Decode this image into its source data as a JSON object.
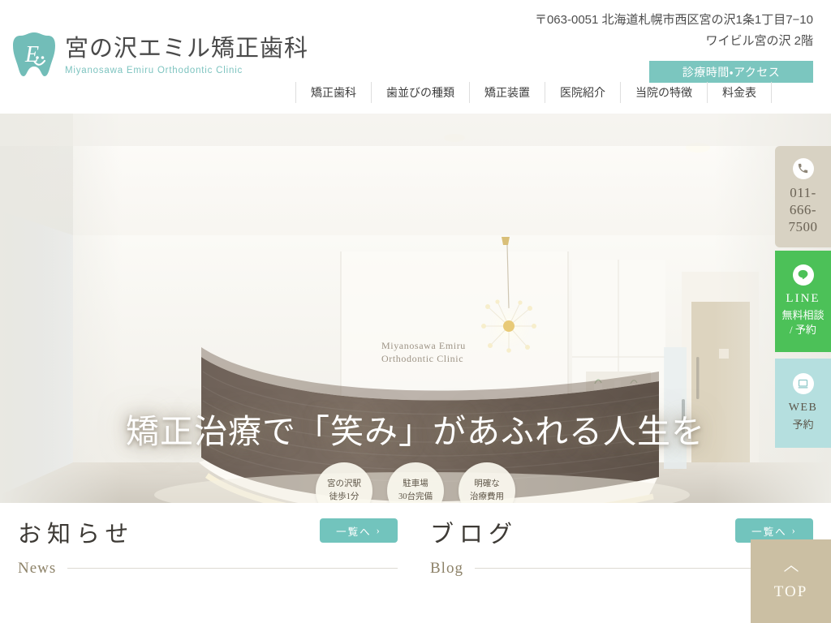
{
  "header": {
    "logo": {
      "icon": "tooth-logo-icon",
      "jp_name": "宮の沢エミル矯正歯科",
      "en_name": "Miyanosawa Emiru Orthodontic Clinic"
    },
    "address_line1": "〒063-0051 北海道札幌市西区宮の沢1条1丁目7−10",
    "address_line2": "ワイビル宮の沢 2階",
    "access_tab_label": "診療時間・アクセス",
    "nav": [
      {
        "label": "矯正歯科",
        "has_dropdown": true
      },
      {
        "label": "歯並びの種類",
        "has_dropdown": false
      },
      {
        "label": "矯正装置",
        "has_dropdown": true
      },
      {
        "label": "医院紹介",
        "has_dropdown": true
      },
      {
        "label": "当院の特徴",
        "has_dropdown": false
      },
      {
        "label": "料金表",
        "has_dropdown": false
      }
    ]
  },
  "hero": {
    "title": "矯正治療で「笑み」があふれる人生を",
    "wall_sign_line1": "Miyanosawa Emiru",
    "wall_sign_line2": "Orthodontic Clinic",
    "badges": [
      {
        "line1": "宮の沢駅",
        "line2": "徒歩1分"
      },
      {
        "line1": "駐車場",
        "line2": "30台完備"
      },
      {
        "line1": "明確な",
        "line2": "治療費用"
      }
    ]
  },
  "side_rail": {
    "tel": {
      "icon": "phone-icon",
      "number": "011-666-7500",
      "lines": [
        "011-",
        "666-",
        "7500"
      ]
    },
    "line": {
      "icon": "line-chat-icon",
      "title": "LINE",
      "sub1": "無料相談",
      "sub2": "/ 予約"
    },
    "web": {
      "icon": "web-reserve-icon",
      "title": "WEB",
      "sub1": "予約"
    }
  },
  "sections": {
    "news": {
      "title": "お知らせ",
      "subtitle": "News",
      "more_label": "一覧へ",
      "more_arrow": "›"
    },
    "blog": {
      "title": "ブログ",
      "subtitle": "Blog",
      "more_label": "一覧へ",
      "more_arrow": "›"
    }
  },
  "top_button": {
    "icon": "chevron-up-icon",
    "label": "TOP"
  },
  "colors": {
    "brand_teal": "#7bc6bf",
    "button_teal": "#72c4bd",
    "line_green": "#4cc158",
    "web_blue": "#b5dfdf",
    "tel_beige": "#d8d2c3",
    "top_tan": "#cbbfa3",
    "text_dark": "#3d3a35",
    "sub_gold": "#8d8268"
  }
}
